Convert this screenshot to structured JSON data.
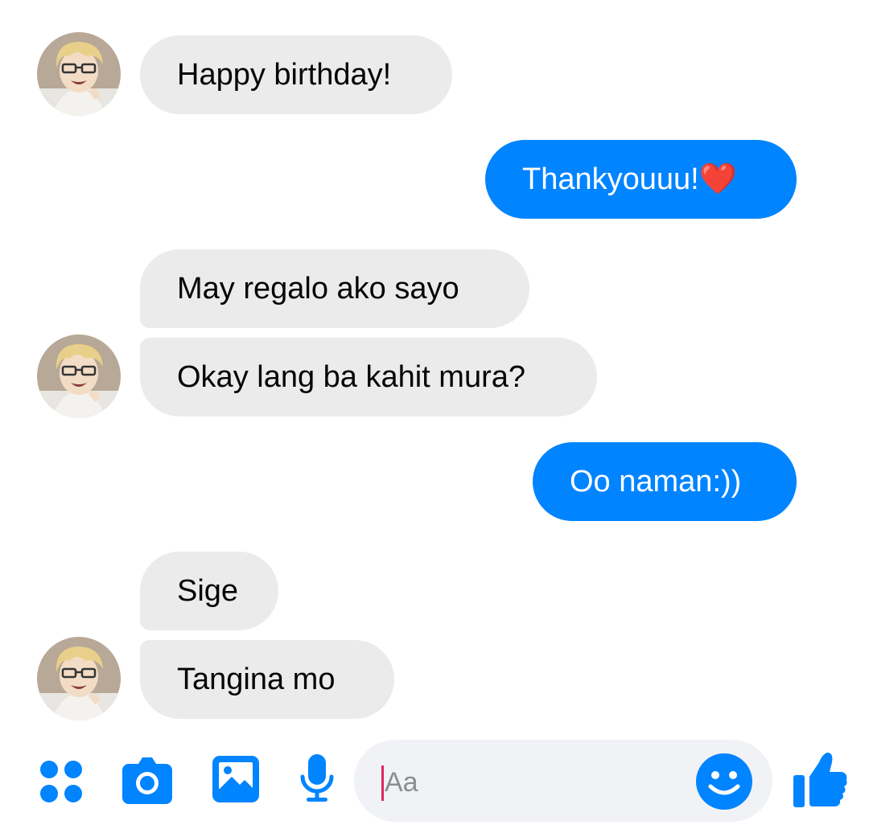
{
  "messages": [
    {
      "id": "m1",
      "side": "incoming",
      "text": "Happy birthday!"
    },
    {
      "id": "m2",
      "side": "outgoing",
      "text": "Thankyouuu!❤️"
    },
    {
      "id": "m3",
      "side": "incoming",
      "text": "May regalo ako sayo"
    },
    {
      "id": "m4",
      "side": "incoming",
      "text": "Okay lang ba kahit mura?"
    },
    {
      "id": "m5",
      "side": "outgoing",
      "text": "Oo naman:))"
    },
    {
      "id": "m6",
      "side": "incoming",
      "text": "Sige"
    },
    {
      "id": "m7",
      "side": "incoming",
      "text": "Tangina mo"
    }
  ],
  "composer": {
    "placeholder": "Aa",
    "icons": [
      "menu-dots-icon",
      "camera-icon",
      "image-icon",
      "microphone-icon",
      "emoji-icon",
      "thumbs-up-icon"
    ]
  },
  "colors": {
    "accent": "#0084ff",
    "incoming_bubble": "#ebebeb",
    "outgoing_text": "#ffffff",
    "caret": "#e0245e"
  }
}
